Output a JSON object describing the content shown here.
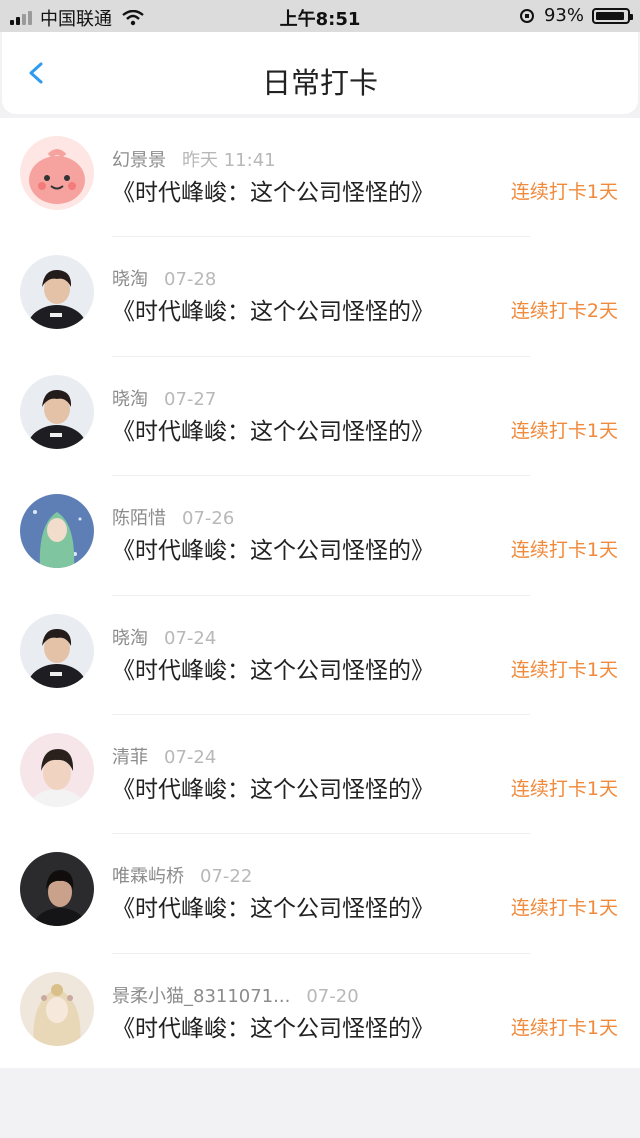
{
  "status_bar": {
    "carrier": "中国联通",
    "time": "上午8:51",
    "battery": "93%",
    "battery_level": 0.93
  },
  "nav": {
    "title": "日常打卡",
    "back_icon": "chevron-left-icon"
  },
  "colors": {
    "accent_blue": "#2e9bf0",
    "streak_orange": "#f08a3c"
  },
  "entries": [
    {
      "name": "幻景景",
      "date": "昨天 11:41",
      "title": "《时代峰峻：这个公司怪怪的》",
      "streak": "连续打卡1天",
      "avatar": "cartoon-avatar"
    },
    {
      "name": "晓淘",
      "date": "07-28",
      "title": "《时代峰峻：这个公司怪怪的》",
      "streak": "连续打卡2天",
      "avatar": "photo-avatar"
    },
    {
      "name": "晓淘",
      "date": "07-27",
      "title": "《时代峰峻：这个公司怪怪的》",
      "streak": "连续打卡1天",
      "avatar": "photo-avatar"
    },
    {
      "name": "陈陌惜",
      "date": "07-26",
      "title": "《时代峰峻：这个公司怪怪的》",
      "streak": "连续打卡1天",
      "avatar": "anime-avatar"
    },
    {
      "name": "晓淘",
      "date": "07-24",
      "title": "《时代峰峻：这个公司怪怪的》",
      "streak": "连续打卡1天",
      "avatar": "photo-avatar"
    },
    {
      "name": "清菲",
      "date": "07-24",
      "title": "《时代峰峻：这个公司怪怪的》",
      "streak": "连续打卡1天",
      "avatar": "photo-avatar"
    },
    {
      "name": "唯霖屿桥",
      "date": "07-22",
      "title": "《时代峰峻：这个公司怪怪的》",
      "streak": "连续打卡1天",
      "avatar": "photo-avatar"
    },
    {
      "name": "景柔小猫_8311071...",
      "date": "07-20",
      "title": "《时代峰峻：这个公司怪怪的》",
      "streak": "连续打卡1天",
      "avatar": "illustration-avatar"
    }
  ]
}
